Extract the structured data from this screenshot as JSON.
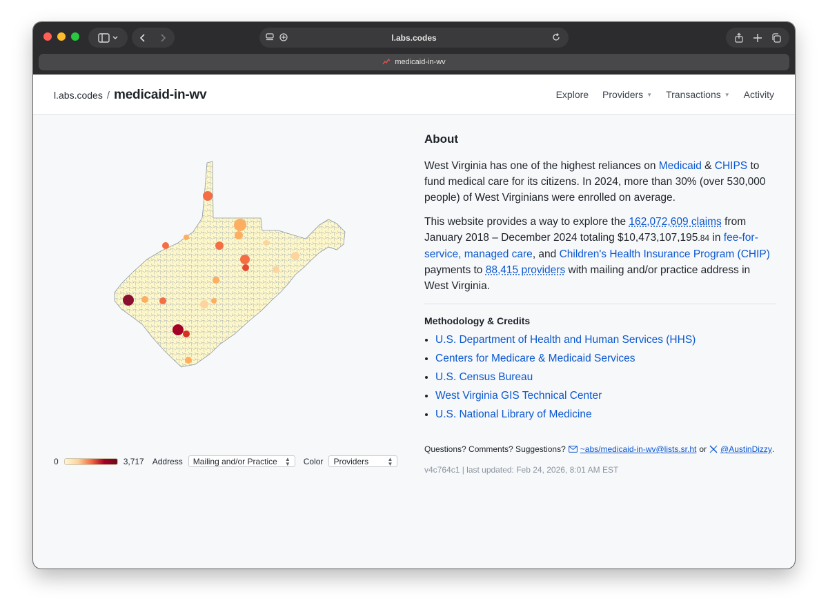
{
  "browser": {
    "url": "l.abs.codes",
    "tab_title": "medicaid-in-wv"
  },
  "header": {
    "site": "l.abs.codes",
    "separator": "/",
    "title": "medicaid-in-wv",
    "nav": [
      {
        "label": "Explore"
      },
      {
        "label": "Providers"
      },
      {
        "label": "Transactions"
      },
      {
        "label": "Activity"
      }
    ]
  },
  "legend": {
    "min": "0",
    "max": "3,717",
    "address_label": "Address",
    "address_value": "Mailing and/or Practice",
    "color_label": "Color",
    "color_value": "Providers"
  },
  "about": {
    "heading": "About",
    "p1_a": "West Virginia has one of the highest reliances on ",
    "p1_link1": "Medicaid",
    "p1_amp": " & ",
    "p1_link2": "CHIPS",
    "p1_b": " to fund medical care for its citizens. In 2024, more than 30% (over 530,000 people) of West Virginians were enrolled on average.",
    "p2_a": "This website provides a way to explore the ",
    "p2_claims": "162,072,609 claims",
    "p2_b": " from January 2018 – December 2024 totaling ",
    "p2_amount": "$10,473,107,195",
    "p2_cents": ".84",
    "p2_c": " in ",
    "p2_link_ffs": "fee-for-service, managed care",
    "p2_d": ", and ",
    "p2_link_chip": "Children's Health Insurance Program (CHIP)",
    "p2_e": " payments to ",
    "p2_providers": "88,415 providers",
    "p2_f": " with mailing and/or practice address in West Virginia."
  },
  "methodology": {
    "heading": "Methodology & Credits",
    "credits": [
      "U.S. Department of Health and Human Services (HHS)",
      "Centers for Medicare & Medicaid Services",
      "U.S. Census Bureau",
      "West Virginia GIS Technical Center",
      "U.S. National Library of Medicine"
    ]
  },
  "footer": {
    "questions": "Questions? Comments? Suggestions?",
    "email": "~abs/medicaid-in-wv@lists.sr.ht",
    "or": "or",
    "twitter": "@AustinDizzy",
    "period": ".",
    "version": "v4c764c1 | last updated: Feb 24, 2026, 8:01 AM EST"
  },
  "colors": {
    "link": "#0b57d0",
    "map_low": "#fff6d5",
    "map_mid": "#f46d43",
    "map_high": "#a50026"
  }
}
